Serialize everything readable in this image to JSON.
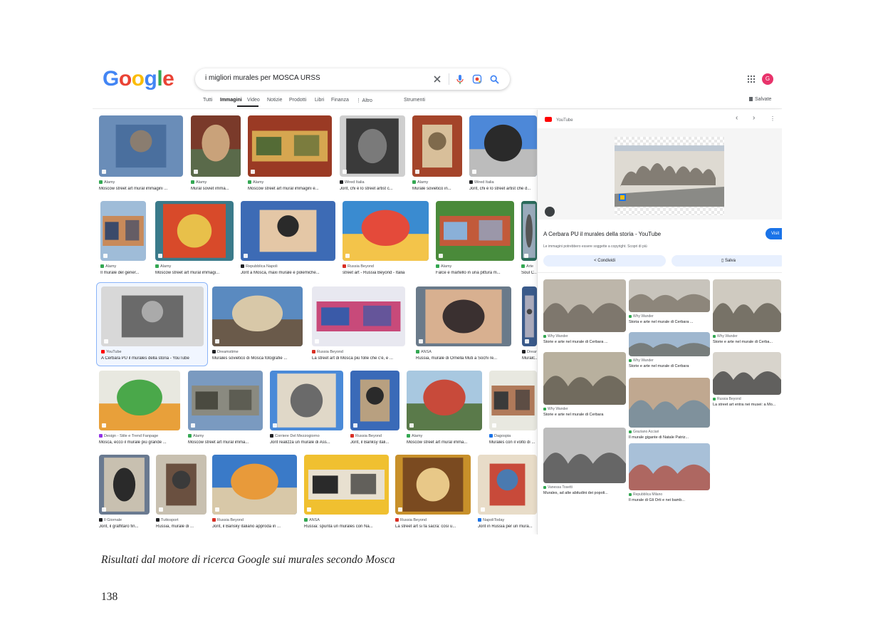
{
  "search": {
    "logo": [
      "G",
      "o",
      "o",
      "g",
      "l",
      "e"
    ],
    "logo_colors": [
      "#4285F4",
      "#EA4335",
      "#FBBC05",
      "#4285F4",
      "#34A853",
      "#EA4335"
    ],
    "query": "i migliori murales per MOSCA URSS",
    "avatar_letter": "G"
  },
  "tabs": {
    "items": [
      "Tutti",
      "Immagini",
      "Video",
      "Notizie",
      "Prodotti",
      "Libri",
      "Finanza",
      "⋮ Altro"
    ],
    "tools": "Strumenti",
    "saved": "Salvate"
  },
  "results": [
    {
      "src": "Alamy",
      "title": "Moscow street art mural immagini ...",
      "c": "#34a853",
      "palette": [
        "#6a8db8",
        "#4a6f9e",
        "#8a7d70"
      ]
    },
    {
      "src": "Alamy",
      "title": "Mural soviet imma...",
      "c": "#34a853",
      "palette": [
        "#7a3a2a",
        "#c9a27a",
        "#5a6a4a"
      ]
    },
    {
      "src": "Alamy",
      "title": "Moscow street art mural immagini e...",
      "c": "#34a853",
      "palette": [
        "#9a3a24",
        "#d6a650",
        "#546b36"
      ]
    },
    {
      "src": "Wired Italia",
      "title": "Jorit, chi è lo street artist c...",
      "c": "#202124",
      "palette": [
        "#cfcfcf",
        "#3a3a3a",
        "#7a7a7a"
      ]
    },
    {
      "src": "Alamy",
      "title": "Murale sovietico in...",
      "c": "#34a853",
      "palette": [
        "#a4442a",
        "#d8bf9a",
        "#7f6a4c"
      ]
    },
    {
      "src": "Wired Italia",
      "title": "Jorit, chi è lo street artist che d...",
      "c": "#202124",
      "palette": [
        "#4d88d8",
        "#2a2a2a",
        "#bcbcbc"
      ]
    },
    {
      "src": "Alamy",
      "title": "Il murale del gener...",
      "c": "#34a853",
      "palette": [
        "#9fbcd8",
        "#c88a5a",
        "#3b4a6a"
      ]
    },
    {
      "src": "Alamy",
      "title": "Moscow street art mural immagi...",
      "c": "#34a853",
      "palette": [
        "#3a7a8a",
        "#d84a2a",
        "#e8c04a"
      ]
    },
    {
      "src": "Repubblica Napoli",
      "title": "Jorit a Mosca, maxi murale e polemiche...",
      "c": "#202124",
      "palette": [
        "#3d6bb5",
        "#e4c7a6",
        "#2a2a2a"
      ]
    },
    {
      "src": "Russia Beyond",
      "title": "street art - Russia Beyond - Italia",
      "c": "#d93025",
      "palette": [
        "#3a8bd0",
        "#e44a3a",
        "#f3c44a"
      ]
    },
    {
      "src": "Alamy",
      "title": "Falce e martello in una pittura m...",
      "c": "#34a853",
      "palette": [
        "#4a8a3a",
        "#c25a3a",
        "#8ab0d8"
      ]
    },
    {
      "src": "Arte",
      "title": "Soul C...",
      "c": "#34a853",
      "palette": [
        "#2a6a5a",
        "#9ab",
        "#555"
      ]
    },
    {
      "src": "YouTube",
      "title": "A Cerbara PU il murales della storia - YouTube",
      "c": "#ff0000",
      "palette": [
        "#d8d8d8",
        "#6a6a6a",
        "#aaaaaa"
      ]
    },
    {
      "src": "Dreamstime",
      "title": "Murales sovietico di Mosca fotografie ...",
      "c": "#202124",
      "palette": [
        "#5a8ac0",
        "#d8c8a8",
        "#6a5a4a"
      ]
    },
    {
      "src": "Russia Beyond",
      "title": "La street art di Mosca più folle che c'è, e ...",
      "c": "#d93025",
      "palette": [
        "#e8e8f0",
        "#c84a7a",
        "#3a5aa8"
      ]
    },
    {
      "src": "ANSA",
      "title": "Russia, murale di Ornella Muti a Sochi re...",
      "c": "#34a853",
      "palette": [
        "#6a7a8a",
        "#d8b090",
        "#3a3030"
      ]
    },
    {
      "src": "Drean",
      "title": "Muralc...",
      "c": "#202124",
      "palette": [
        "#3a5a8a",
        "#aab",
        "#444"
      ]
    },
    {
      "src": "Design - Stile e Trend Fanpage",
      "title": "Mosca, ecco il murale più grande ...",
      "c": "#9334e6",
      "palette": [
        "#e8e8e0",
        "#4aa84a",
        "#e8a03a"
      ]
    },
    {
      "src": "Alamy",
      "title": "Moscow street art mural imma...",
      "c": "#34a853",
      "palette": [
        "#7a9ac0",
        "#8a8a80",
        "#4a4a40"
      ]
    },
    {
      "src": "Corriere Del Mezzogiorno",
      "title": "Jorit realizza un murale di Ass...",
      "c": "#202124",
      "palette": [
        "#4a8ad8",
        "#e0d8c8",
        "#6a6a6a"
      ]
    },
    {
      "src": "Russia Beyond",
      "title": "Jorit, il Banksy itali...",
      "c": "#d93025",
      "palette": [
        "#3a6ab8",
        "#b8a080",
        "#2a2a2a"
      ]
    },
    {
      "src": "Alamy",
      "title": "Moscow street art mural imma...",
      "c": "#34a853",
      "palette": [
        "#a8c8e0",
        "#c84a3a",
        "#5a7a4a"
      ]
    },
    {
      "src": "Dagospia",
      "title": "Murales con il volto di ...",
      "c": "#1a73e8",
      "palette": [
        "#e8e8e0",
        "#b07a5a",
        "#3a3a3a"
      ]
    },
    {
      "src": "Il Giornale",
      "title": "Jorit, il graffitaro fin...",
      "c": "#202124",
      "palette": [
        "#6a7a90",
        "#c8c0b0",
        "#2a2a2a"
      ]
    },
    {
      "src": "Tuttosport",
      "title": "Russia, murale di ...",
      "c": "#202124",
      "palette": [
        "#c8c0b0",
        "#6a5040",
        "#3a3a3a"
      ]
    },
    {
      "src": "Russia Beyond",
      "title": "Jorit, il Bansky italiano approda in ...",
      "c": "#d93025",
      "palette": [
        "#3a7ac8",
        "#e89a3a",
        "#d8c8a8"
      ]
    },
    {
      "src": "ANSA",
      "title": "Russia: spunta un murales con Na...",
      "c": "#34a853",
      "palette": [
        "#f0c030",
        "#e8e0d0",
        "#2a2a2a"
      ]
    },
    {
      "src": "Russia Beyond",
      "title": "La street art si fa sacra: così u...",
      "c": "#d93025",
      "palette": [
        "#c8902a",
        "#7a4a20",
        "#e8c888"
      ]
    },
    {
      "src": "NapoliToday",
      "title": "Jorit in Russia per un mura...",
      "c": "#1a73e8",
      "palette": [
        "#e8dcc8",
        "#c84a3a",
        "#4a7ab0"
      ]
    }
  ],
  "panel": {
    "source": "YouTube",
    "title": "A Cerbara PU il murales della storia - YouTube",
    "visit": "Visit",
    "note": "Le immagini potrebbero essere soggette a copyright. Scopri di più",
    "share": "Condividi",
    "save": "Salva",
    "related": [
      {
        "src": "Why Wander",
        "title": "Storie e arte nel murale di Cerbara ..."
      },
      {
        "src": "Why Wander",
        "title": "Storia e arte nel murale di Cerbara ..."
      },
      {
        "src": "Why Wander",
        "title": "Storie e arte nel murale di Cerba..."
      },
      {
        "src": "Why Wander",
        "title": "Storie e arte nel murale di Cerbara"
      },
      {
        "src": "Why Wander",
        "title": "Storie e arte nel murale di Cerbara"
      },
      {
        "src": "Graziano Acciari",
        "title": "Il murale gigante di Natale Patriz..."
      },
      {
        "src": "Russia Beyond",
        "title": "La street art entra nei musei: a Mo..."
      },
      {
        "src": "Vanessa Tosetti",
        "title": "Murales, ad alte abitudini dei popoli..."
      },
      {
        "src": "Repubblica Milano",
        "title": "Il murale di Gli Orti e nei bamb..."
      }
    ]
  },
  "caption": "Risultati dal motore di ricerca Google sui murales secondo Mosca",
  "page_number": "138"
}
